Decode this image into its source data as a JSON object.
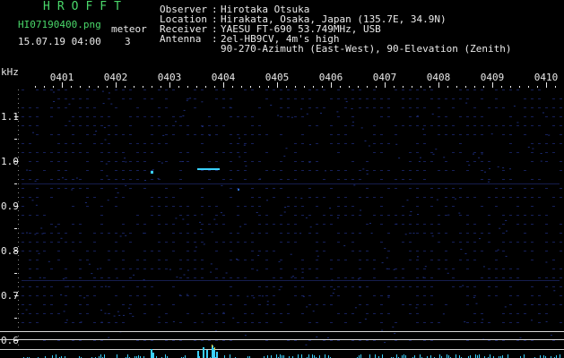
{
  "header": {
    "app_title": "HROFFT",
    "filename": "HI07190400.png",
    "datetime": "15.07.19 04:00",
    "meteor_label": "meteor",
    "meteor_count": "3"
  },
  "station_info": [
    {
      "key": "Observer",
      "sep": ":",
      "value": "Hirotaka Otsuka"
    },
    {
      "key": "Location",
      "sep": ":",
      "value": "Hirakata, Osaka, Japan (135.7E, 34.9N)"
    },
    {
      "key": "Receiver",
      "sep": ":",
      "value": "YAESU FT-690 53.749MHz, USB"
    },
    {
      "key": "Antenna",
      "sep": ":",
      "value": "2el-HB9CV, 4m's high"
    },
    {
      "key": "",
      "sep": "",
      "value": "90-270-Azimuth (East-West), 90-Elevation (Zenith)"
    }
  ],
  "spectrogram": {
    "y_unit": "kHz",
    "time_labels": [
      "0401",
      "0402",
      "0403",
      "0404",
      "0405",
      "0406",
      "0407",
      "0408",
      "0409",
      "0410"
    ],
    "freq_labels": [
      "1.1",
      "1.0",
      "0.9",
      "0.8",
      "0.7",
      "0.6"
    ],
    "colors": {
      "background": "#000000",
      "grid": "#16205a",
      "signal": "#3ad0ff",
      "baseline": "#d8d8d8",
      "axis_text": "#eaeaea"
    }
  }
}
